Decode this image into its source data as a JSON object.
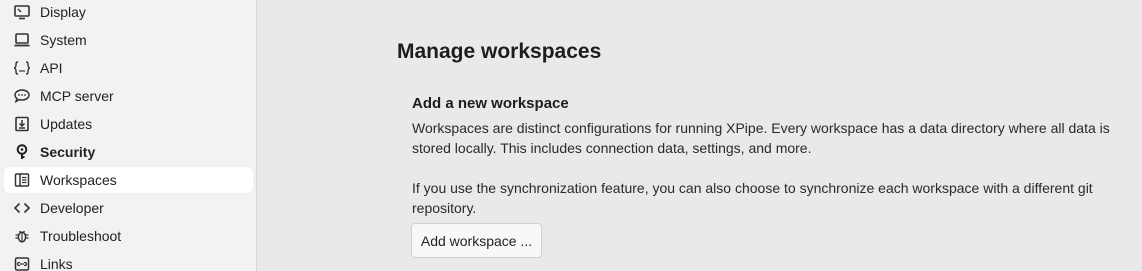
{
  "sidebar": {
    "items": [
      {
        "label": "Display",
        "icon": "monitor-icon",
        "bold": false,
        "active": false
      },
      {
        "label": "System",
        "icon": "laptop-icon",
        "bold": false,
        "active": false
      },
      {
        "label": "API",
        "icon": "braces-icon",
        "bold": false,
        "active": false
      },
      {
        "label": "MCP server",
        "icon": "chat-bubble-icon",
        "bold": false,
        "active": false
      },
      {
        "label": "Updates",
        "icon": "download-box-icon",
        "bold": false,
        "active": false
      },
      {
        "label": "Security",
        "icon": "shield-key-icon",
        "bold": true,
        "active": false
      },
      {
        "label": "Workspaces",
        "icon": "book-icon",
        "bold": false,
        "active": true
      },
      {
        "label": "Developer",
        "icon": "code-brackets-icon",
        "bold": false,
        "active": false
      },
      {
        "label": "Troubleshoot",
        "icon": "bug-icon",
        "bold": false,
        "active": false
      },
      {
        "label": "Links",
        "icon": "link-box-icon",
        "bold": false,
        "active": false
      }
    ]
  },
  "main": {
    "title": "Manage workspaces",
    "section": {
      "title": "Add a new workspace",
      "description_1": "Workspaces are distinct configurations for running XPipe. Every workspace has a data directory where all data is stored locally. This includes connection data, settings, and more.",
      "description_2": "If you use the synchronization feature, you can also choose to synchronize each workspace with a different git repository.",
      "button_label": "Add workspace ..."
    }
  }
}
